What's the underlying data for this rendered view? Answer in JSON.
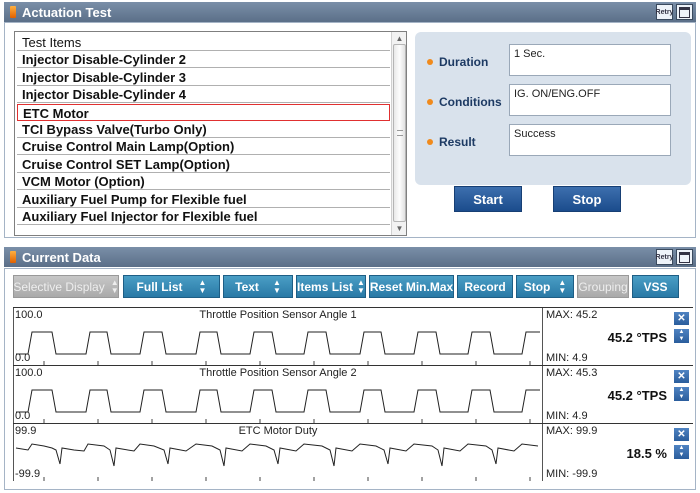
{
  "actuation": {
    "title": "Actuation Test",
    "retry_label": "Retry",
    "list_header": "Test Items",
    "items": [
      "Injector Disable-Cylinder 2",
      "Injector Disable-Cylinder 3",
      "Injector Disable-Cylinder 4",
      "ETC Motor",
      "TCI Bypass Valve(Turbo Only)",
      "Cruise Control Main Lamp(Option)",
      "Cruise Control SET Lamp(Option)",
      "VCM Motor (Option)",
      "Auxiliary Fuel Pump for Flexible fuel",
      "Auxiliary Fuel Injector for Flexible fuel"
    ],
    "selected_item": "ETC Motor",
    "duration_label": "Duration",
    "duration_value": "1 Sec.",
    "conditions_label": "Conditions",
    "conditions_value": "IG. ON/ENG.OFF",
    "result_label": "Result",
    "result_value": "Success",
    "start_label": "Start",
    "stop_label": "Stop"
  },
  "current": {
    "title": "Current Data",
    "retry_label": "Retry",
    "toolbar": {
      "selective_display": "Selective Display",
      "full_list": "Full List",
      "text": "Text",
      "items_list": "Items List",
      "reset_minmax": "Reset Min.Max",
      "record": "Record",
      "stop": "Stop",
      "grouping": "Grouping",
      "vss": "VSS"
    },
    "graphs": [
      {
        "name": "Throttle Position Sensor Angle 1",
        "y_top": "100.0",
        "y_bottom": "0.0",
        "max": "MAX: 45.2",
        "value": "45.2 °TPS",
        "min": "MIN: 4.9"
      },
      {
        "name": "Throttle Position Sensor Angle 2",
        "y_top": "100.0",
        "y_bottom": "0.0",
        "max": "MAX: 45.3",
        "value": "45.2 °TPS",
        "min": "MIN: 4.9"
      },
      {
        "name": "ETC Motor Duty",
        "y_top": "99.9",
        "y_bottom": "-99.9",
        "max": "MAX: 99.9",
        "value": "18.5 %",
        "min": "MIN: -99.9"
      }
    ]
  },
  "colors": {
    "title_bar": "#6a7f99",
    "button_blue": "#1b4c8c",
    "tool_button": "#2979a6",
    "selection_border": "#e03030",
    "bullet_orange": "#f08a1c"
  }
}
